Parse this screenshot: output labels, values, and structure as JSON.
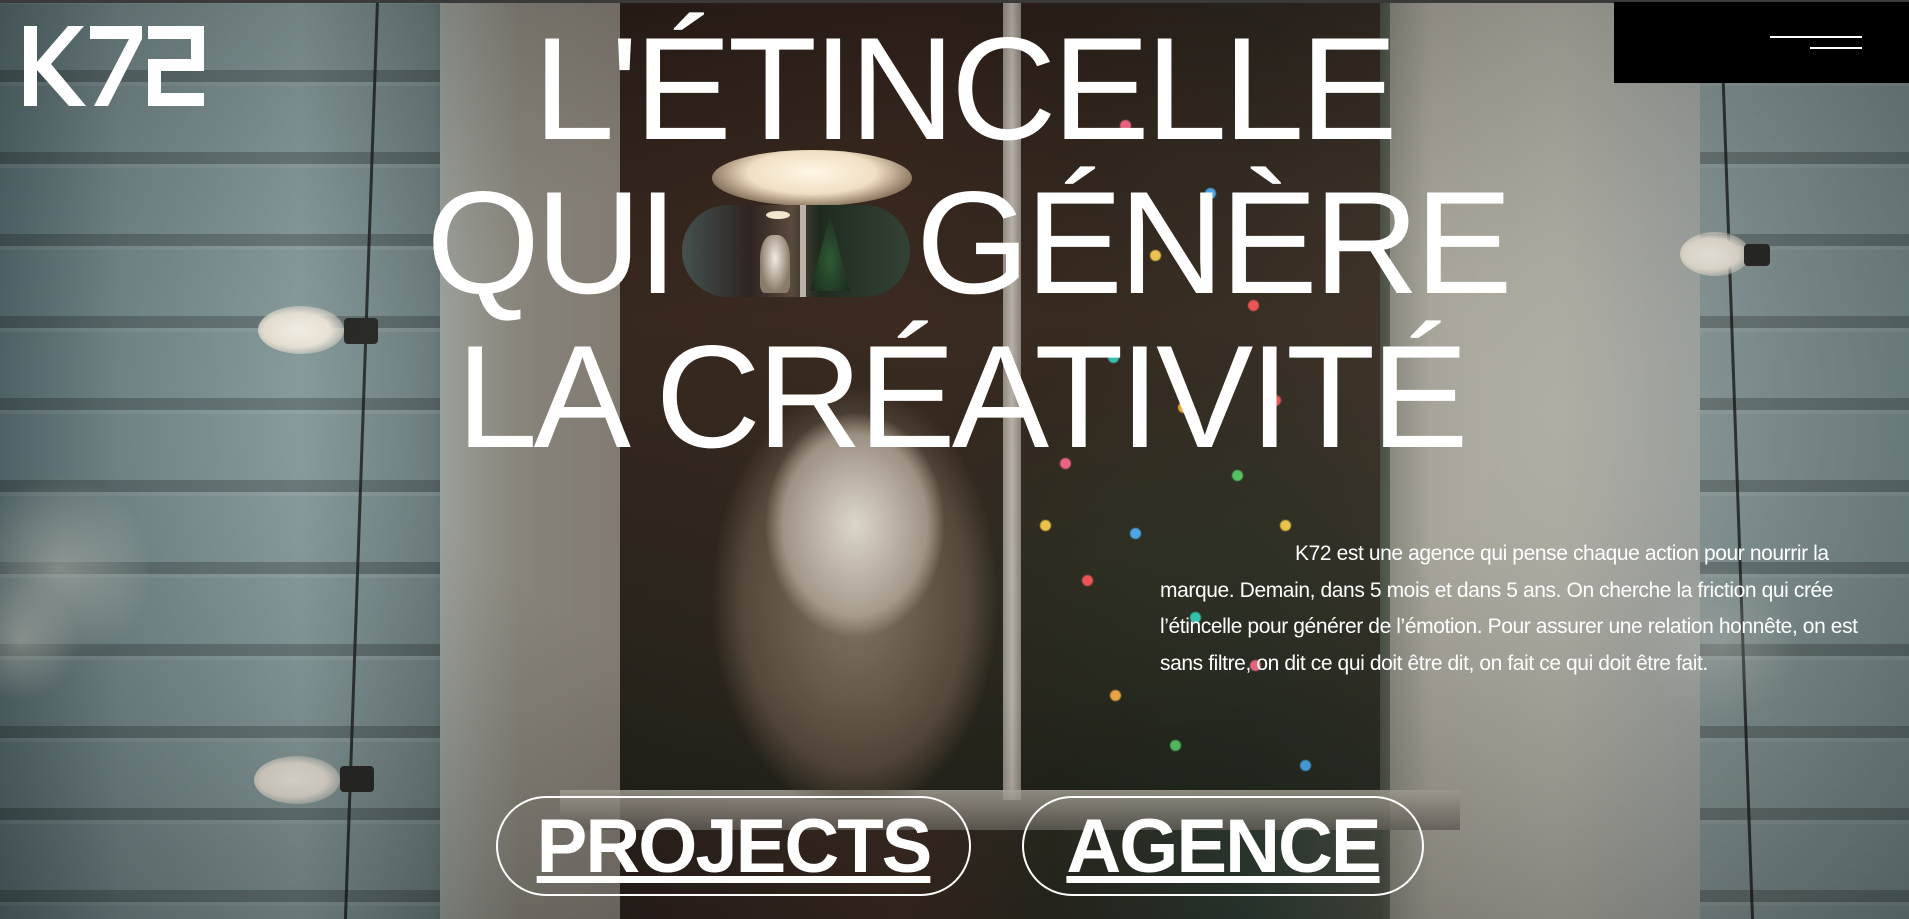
{
  "brand": {
    "logo_text": "K72"
  },
  "menu": {
    "aria_label": "Menu"
  },
  "hero": {
    "headline_line1": "L'ÉTINCELLE",
    "headline_line2_before": "QUI",
    "headline_line2_after": "GÉNÈRE",
    "headline_line3": "LA CRÉATIVITÉ",
    "intro": "K72 est une agence qui pense chaque action pour nourrir la marque. Demain, dans 5 mois et dans 5 ans. On cherche la friction qui crée l’étincelle pour générer de l’émotion. Pour assurer une relation honnête, on est sans filtre, on dit ce qui doit être dit, on fait ce qui doit être fait."
  },
  "nav": {
    "projects_label": "PROJECTS",
    "agence_label": "AGENCE"
  },
  "colors": {
    "text": "#ffffff",
    "menu_background": "#000000",
    "button_border": "#ffffff"
  },
  "icons": {
    "menu": "hamburger-icon",
    "logo": "k72-logo"
  }
}
